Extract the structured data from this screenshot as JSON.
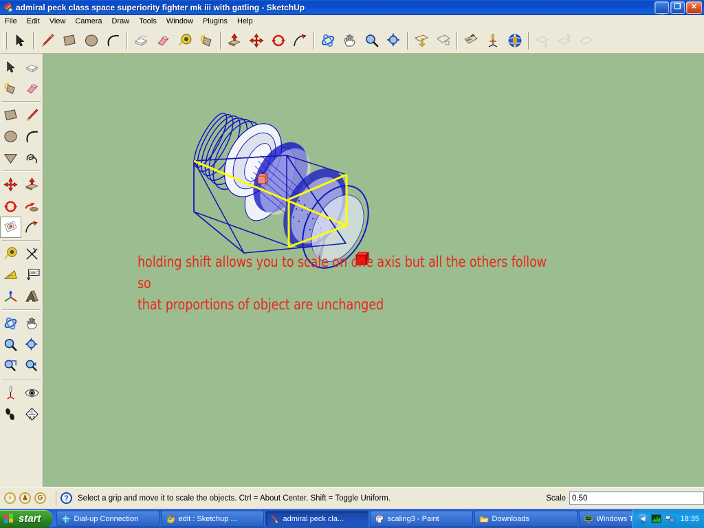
{
  "window": {
    "title": "admiral peck class space superiority fighter mk iii with gatling - SketchUp",
    "icon": "sketchup-saber-icon",
    "minimize_label": "_",
    "maximize_label": "❐",
    "close_label": "✕"
  },
  "menu": {
    "items": [
      {
        "label": "File"
      },
      {
        "label": "Edit"
      },
      {
        "label": "View"
      },
      {
        "label": "Camera"
      },
      {
        "label": "Draw"
      },
      {
        "label": "Tools"
      },
      {
        "label": "Window"
      },
      {
        "label": "Plugins"
      },
      {
        "label": "Help"
      }
    ]
  },
  "toolbar": {
    "groups": [
      {
        "buttons": [
          {
            "name": "select-tool",
            "icon": "arrow-cursor-icon",
            "enabled": true
          }
        ]
      },
      {
        "buttons": [
          {
            "name": "line-tool",
            "icon": "pencil-icon",
            "enabled": true
          },
          {
            "name": "rectangle-tool",
            "icon": "rectangle-icon",
            "enabled": true
          },
          {
            "name": "circle-tool",
            "icon": "circle-icon",
            "enabled": true
          },
          {
            "name": "arc-tool",
            "icon": "arc-icon",
            "enabled": true
          }
        ]
      },
      {
        "buttons": [
          {
            "name": "make-component-tool",
            "icon": "component-box-icon",
            "enabled": true
          },
          {
            "name": "eraser-tool",
            "icon": "eraser-icon",
            "enabled": true
          },
          {
            "name": "tape-measure-tool",
            "icon": "tape-measure-icon",
            "enabled": true
          },
          {
            "name": "paint-bucket-tool",
            "icon": "paint-bucket-icon",
            "enabled": true
          }
        ]
      },
      {
        "buttons": [
          {
            "name": "push-pull-tool",
            "icon": "push-pull-icon",
            "enabled": true
          },
          {
            "name": "move-tool",
            "icon": "move-arrows-icon",
            "enabled": true
          },
          {
            "name": "rotate-tool",
            "icon": "rotate-arrows-icon",
            "enabled": true
          },
          {
            "name": "follow-me-tool",
            "icon": "follow-me-icon",
            "enabled": true
          }
        ]
      },
      {
        "buttons": [
          {
            "name": "orbit-tool",
            "icon": "orbit-icon",
            "enabled": true
          },
          {
            "name": "pan-tool",
            "icon": "hand-icon",
            "enabled": true
          },
          {
            "name": "zoom-tool",
            "icon": "magnifier-icon",
            "enabled": true
          },
          {
            "name": "zoom-extents-tool",
            "icon": "zoom-extents-icon",
            "enabled": true
          }
        ]
      },
      {
        "buttons": [
          {
            "name": "section-plane-tool",
            "icon": "section-plane-icon",
            "enabled": true
          },
          {
            "name": "display-section-cuts",
            "icon": "section-cut-icon",
            "enabled": true
          }
        ]
      },
      {
        "buttons": [
          {
            "name": "photo-match-tool",
            "icon": "photo-match-icon",
            "enabled": true
          },
          {
            "name": "position-camera-tool",
            "icon": "position-camera-icon",
            "enabled": true
          },
          {
            "name": "get-models-warehouse",
            "icon": "warehouse-globe-icon",
            "enabled": true
          }
        ]
      },
      {
        "buttons": [
          {
            "name": "get-component-tool",
            "icon": "get-component-icon",
            "enabled": false
          },
          {
            "name": "share-component-tool",
            "icon": "share-component-icon",
            "enabled": false
          },
          {
            "name": "share-model-tool",
            "icon": "share-model-icon",
            "enabled": false
          }
        ]
      }
    ]
  },
  "tool_palette": {
    "name": "large-tool-set",
    "groups": [
      {
        "buttons": [
          {
            "name": "select-tool",
            "icon": "arrow-cursor-icon"
          },
          {
            "name": "make-component-tool",
            "icon": "component-box-icon"
          },
          {
            "name": "paint-bucket-tool",
            "icon": "paint-bucket-icon"
          },
          {
            "name": "eraser-tool",
            "icon": "eraser-icon"
          }
        ]
      },
      {
        "buttons": [
          {
            "name": "rectangle-tool",
            "icon": "rectangle-icon"
          },
          {
            "name": "line-tool",
            "icon": "pencil-icon"
          },
          {
            "name": "circle-tool",
            "icon": "circle-icon"
          },
          {
            "name": "arc-tool",
            "icon": "arc-icon"
          },
          {
            "name": "polygon-tool",
            "icon": "polygon-icon"
          },
          {
            "name": "freehand-tool",
            "icon": "freehand-icon"
          }
        ]
      },
      {
        "buttons": [
          {
            "name": "move-tool",
            "icon": "move-arrows-icon"
          },
          {
            "name": "push-pull-tool",
            "icon": "push-pull-icon"
          },
          {
            "name": "rotate-tool",
            "icon": "rotate-arrows-icon"
          },
          {
            "name": "scale-tool",
            "icon": "scale-icon",
            "active": true
          },
          {
            "name": "offset-tool",
            "icon": "offset-icon"
          },
          {
            "name": "follow-me-tool",
            "icon": "follow-me-icon"
          }
        ]
      },
      {
        "buttons": [
          {
            "name": "tape-measure-tool",
            "icon": "tape-measure-icon"
          },
          {
            "name": "dimension-tool",
            "icon": "dimension-icon"
          },
          {
            "name": "protractor-tool",
            "icon": "protractor-icon"
          },
          {
            "name": "text-tool",
            "icon": "text-abc-icon"
          },
          {
            "name": "axes-tool",
            "icon": "axes-icon"
          },
          {
            "name": "three-d-text-tool",
            "icon": "three-d-text-icon"
          }
        ]
      },
      {
        "buttons": [
          {
            "name": "orbit-tool",
            "icon": "orbit-icon"
          },
          {
            "name": "pan-tool",
            "icon": "hand-icon"
          },
          {
            "name": "zoom-tool",
            "icon": "magnifier-icon"
          },
          {
            "name": "zoom-extents-tool",
            "icon": "zoom-extents-icon"
          },
          {
            "name": "zoom-window-tool",
            "icon": "zoom-window-icon"
          },
          {
            "name": "previous-view-tool",
            "icon": "previous-view-icon"
          }
        ]
      },
      {
        "buttons": [
          {
            "name": "position-camera-tool",
            "icon": "position-camera-icon"
          },
          {
            "name": "look-around-tool",
            "icon": "eye-icon"
          },
          {
            "name": "walk-tool",
            "icon": "footprints-icon"
          },
          {
            "name": "section-plane-tool",
            "icon": "section-sign-icon"
          }
        ]
      }
    ]
  },
  "canvas": {
    "background_color": "#9cbd90",
    "model_name": "gatling-fighter-model",
    "selection_color": "#1515c8",
    "highlight_edge_color": "#ffff00",
    "grip_active_color": "#e81010",
    "grip_anchor_color": "#ef8a7a",
    "annotation": "holding shift allows you to scale on one axis but all the others follow so\nthat proportions of object are unchanged",
    "annotation_color": "#e8261c"
  },
  "statusbar": {
    "geo_icons": [
      {
        "name": "geo-location-icon",
        "glyph": "♀"
      },
      {
        "name": "geo-person-icon",
        "glyph": "♟"
      },
      {
        "name": "google-credits-icon",
        "glyph": "G"
      }
    ],
    "help_icon": "question-mark-icon",
    "help_glyph": "?",
    "message": "Select a grip and move it to scale the objects. Ctrl = About Center. Shift = Toggle Uniform.",
    "vcb_label": "Scale",
    "vcb_value": "0.50",
    "vcb_placeholder": ""
  },
  "taskbar": {
    "start_label": "start",
    "tasks": [
      {
        "label": "Dial-up Connection",
        "icon": "network-globe-icon",
        "active": false
      },
      {
        "label": "edit : Sketchup ...",
        "icon": "chrome-icon",
        "active": false
      },
      {
        "label": "admiral peck cla...",
        "icon": "sketchup-saber-icon",
        "active": true
      },
      {
        "label": "scaling3 - Paint",
        "icon": "paint-palette-icon",
        "active": false
      },
      {
        "label": "Downloads",
        "icon": "folder-icon",
        "active": false
      },
      {
        "label": "Windows Task M...",
        "icon": "task-manager-icon",
        "active": false
      }
    ],
    "tray": {
      "arrow_glyph": "◀",
      "icons": [
        {
          "name": "task-manager-tray-icon"
        },
        {
          "name": "network-tray-icon"
        }
      ],
      "clock": "18:35"
    }
  }
}
